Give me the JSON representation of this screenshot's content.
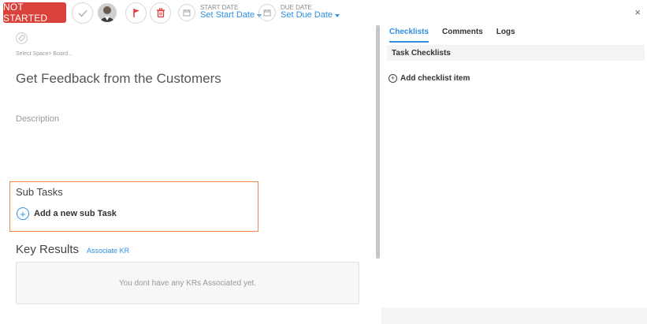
{
  "topbar": {
    "status_label": "NOT STARTED",
    "status_color": "#d9413a",
    "start_date_label": "START DATE",
    "start_date_value": "Set Start Date",
    "due_date_label": "DUE DATE",
    "due_date_value": "Set Due Date",
    "close_glyph": "×",
    "accent_color": "#2f8ee0"
  },
  "task": {
    "breadcrumb": "Select Space> Board...",
    "title": "Get Feedback from the Customers",
    "description_placeholder": "Description"
  },
  "subtasks": {
    "title": "Sub Tasks",
    "add_label": "Add a new sub Task",
    "plus_glyph": "+"
  },
  "key_results": {
    "title": "Key Results",
    "associate_link": "Associate KR",
    "empty_text": "You dont have any KRs Associated yet."
  },
  "right_panel": {
    "tabs": [
      {
        "label": "Checklists",
        "active": true
      },
      {
        "label": "Comments",
        "active": false
      },
      {
        "label": "Logs",
        "active": false
      }
    ],
    "section_title": "Task Checklists",
    "add_checklist_label": "Add checklist item",
    "plus_glyph": "+"
  },
  "icons": {
    "complete": "check-icon",
    "avatar": "avatar",
    "priority": "flag-icon",
    "delete": "trash-icon",
    "calendar": "calendar-icon",
    "tag": "tag-icon"
  }
}
